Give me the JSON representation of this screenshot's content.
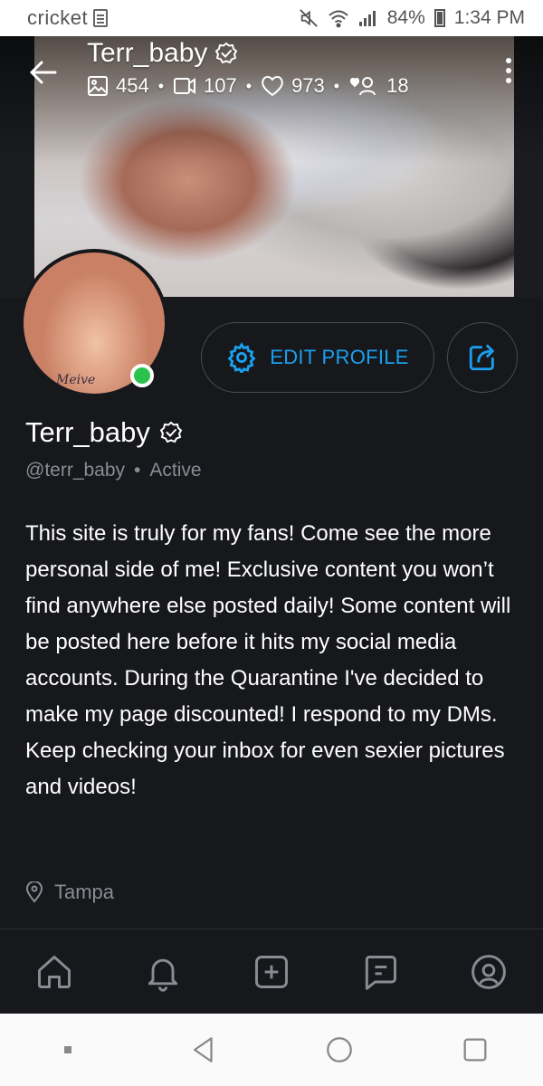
{
  "status_bar": {
    "carrier": "cricket",
    "battery": "84%",
    "time": "1:34 PM"
  },
  "cover": {
    "title": "Terr_baby",
    "stats": {
      "photos": "454",
      "videos": "107",
      "likes": "973",
      "fans": "18"
    }
  },
  "profile": {
    "avatar_caption": "Meive",
    "edit_label": "EDIT PROFILE",
    "name": "Terr_baby",
    "handle": "@terr_baby",
    "separator": "•",
    "status": "Active",
    "bio": "This site is truly for my fans! Come see the more personal side of me! Exclusive content you won’t find anywhere else posted daily! Some content will be posted here before it hits my social media accounts. During the Quarantine I've decided to make my page discounted! I respond to my DMs. Keep checking your inbox for even sexier pictures and videos!",
    "location": "Tampa"
  },
  "colors": {
    "accent": "#1aa0ef",
    "online": "#2bc34e",
    "panel": "#17181c"
  },
  "icons": {
    "nav": [
      "home-icon",
      "bell-icon",
      "plus-square-icon",
      "message-icon",
      "profile-icon"
    ],
    "system": [
      "recents-dot-icon",
      "back-triangle-icon",
      "home-circle-icon",
      "overview-square-icon"
    ]
  }
}
